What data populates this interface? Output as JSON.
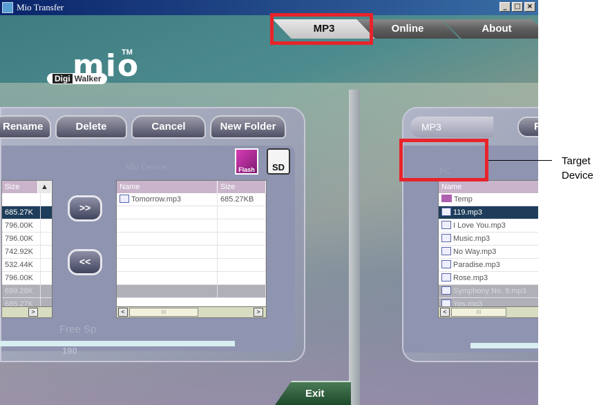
{
  "window": {
    "title": "Mio Transfer",
    "controls": [
      "_",
      "□",
      "×"
    ]
  },
  "tabs": [
    {
      "label": "MP3",
      "active": true
    },
    {
      "label": "Online",
      "active": false
    },
    {
      "label": "About",
      "active": false
    }
  ],
  "logo": {
    "word": "mio",
    "tm": "TM",
    "sub_prefix": "Digi",
    "sub_suffix": "Walker"
  },
  "toolbar": {
    "rename": "Rename",
    "delete": "Delete",
    "cancel": "Cancel",
    "new_folder": "New Folder"
  },
  "left_panel": {
    "device_label": "Mio Device",
    "flash_label": "Flash",
    "sd_label": "SD",
    "pc_list": {
      "col_size": "Size",
      "sizes": [
        "",
        "685.27K",
        "796.00K",
        "796.00K",
        "742.92K",
        "532.44K",
        "796.00K",
        "699.28K",
        "685.27K"
      ]
    },
    "move_right": ">>",
    "move_left": "<<",
    "free_space_label": "Free Sp",
    "free_space_value": "190",
    "device_list": {
      "col_name": "Name",
      "col_size": "Size",
      "rows": [
        {
          "name": "Tomorrow.mp3",
          "size": "685.27KB"
        }
      ]
    }
  },
  "right_panel": {
    "mp3_label": "MP3",
    "f_label": "F",
    "pc_label": "PC",
    "list": {
      "col_name": "Name",
      "rows": [
        {
          "name": "Temp",
          "type": "folder"
        },
        {
          "name": "119.mp3",
          "type": "file",
          "selected": true
        },
        {
          "name": "I Love You.mp3",
          "type": "file"
        },
        {
          "name": "Music.mp3",
          "type": "file"
        },
        {
          "name": "No Way.mp3",
          "type": "file"
        },
        {
          "name": "Paradise.mp3",
          "type": "file"
        },
        {
          "name": "Rose.mp3",
          "type": "file"
        },
        {
          "name": "Symphony No. 9.mp3",
          "type": "file",
          "dim": true
        },
        {
          "name": "Yes.mp3",
          "type": "file",
          "dim": true
        }
      ]
    }
  },
  "annotation": {
    "callout_line1": "Target",
    "callout_line2": "Device"
  },
  "exit_label": "Exit",
  "colors": {
    "highlight": "#e8232a",
    "selected_row": "#1e3d5a",
    "header_bar": "#c9b4cc"
  }
}
